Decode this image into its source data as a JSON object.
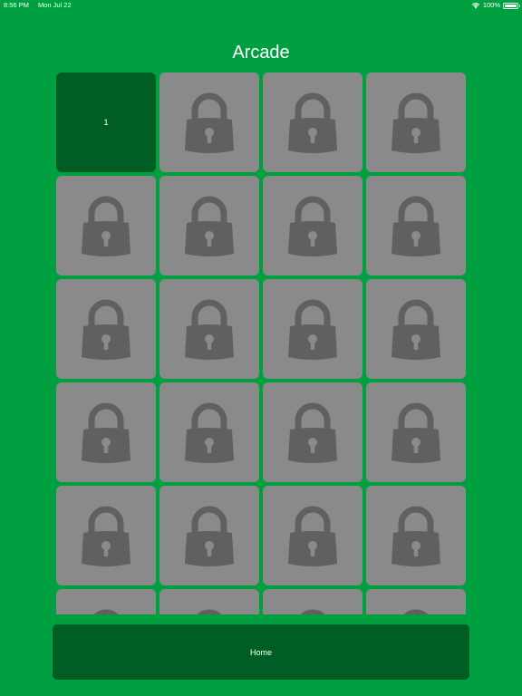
{
  "status_bar": {
    "time": "8:56 PM",
    "date": "Mon Jul 22",
    "battery": "100%"
  },
  "title": "Arcade",
  "levels": [
    {
      "label": "1",
      "locked": false
    },
    {
      "label": "",
      "locked": true
    },
    {
      "label": "",
      "locked": true
    },
    {
      "label": "",
      "locked": true
    },
    {
      "label": "",
      "locked": true
    },
    {
      "label": "",
      "locked": true
    },
    {
      "label": "",
      "locked": true
    },
    {
      "label": "",
      "locked": true
    },
    {
      "label": "",
      "locked": true
    },
    {
      "label": "",
      "locked": true
    },
    {
      "label": "",
      "locked": true
    },
    {
      "label": "",
      "locked": true
    },
    {
      "label": "",
      "locked": true
    },
    {
      "label": "",
      "locked": true
    },
    {
      "label": "",
      "locked": true
    },
    {
      "label": "",
      "locked": true
    },
    {
      "label": "",
      "locked": true
    },
    {
      "label": "",
      "locked": true
    },
    {
      "label": "",
      "locked": true
    },
    {
      "label": "",
      "locked": true
    },
    {
      "label": "",
      "locked": true
    },
    {
      "label": "",
      "locked": true
    },
    {
      "label": "",
      "locked": true
    },
    {
      "label": "",
      "locked": true
    }
  ],
  "home_button": {
    "label": "Home"
  },
  "colors": {
    "background": "#00a040",
    "unlocked_tile": "#005e24",
    "locked_tile": "#8a8a8a",
    "lock_icon": "#606060"
  },
  "icons": {
    "locked_tile_icon": "lock-icon",
    "wifi": "wifi-icon",
    "battery": "battery-icon"
  }
}
